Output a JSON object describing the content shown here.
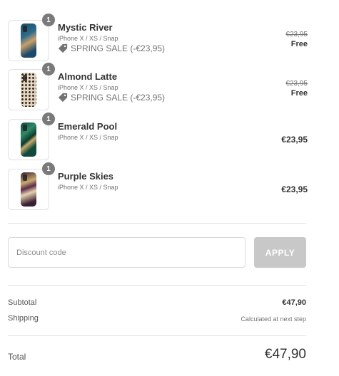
{
  "items": [
    {
      "quantity": "1",
      "name": "Mystic River",
      "variant": "iPhone X / XS / Snap",
      "discount": "SPRING SALE (-€23,95)",
      "original_price": "€23,95",
      "price": "Free",
      "colors": [
        "#1c4a6b",
        "#c9a06a"
      ]
    },
    {
      "quantity": "1",
      "name": "Almond Latte",
      "variant": "iPhone X / XS / Snap",
      "discount": "SPRING SALE (-€23,95)",
      "original_price": "€23,95",
      "price": "Free",
      "colors": [
        "#e3d6c2",
        "#3a2c22"
      ]
    },
    {
      "quantity": "1",
      "name": "Emerald Pool",
      "variant": "iPhone X / XS / Snap",
      "price": "€23,95",
      "colors": [
        "#0f4a3a",
        "#2f8a68"
      ]
    },
    {
      "quantity": "1",
      "name": "Purple Skies",
      "variant": "iPhone X / XS / Snap",
      "price": "€23,95",
      "colors": [
        "#3a1f33",
        "#c9a86e"
      ]
    }
  ],
  "discount_field": {
    "placeholder": "Discount code",
    "apply_label": "APPLY"
  },
  "summary": {
    "subtotal_label": "Subtotal",
    "subtotal_value": "€47,90",
    "shipping_label": "Shipping",
    "shipping_value": "Calculated at next step",
    "total_label": "Total",
    "total_value": "€47,90"
  },
  "icons": {
    "discount": "tag-icon"
  },
  "colors": {
    "badge": "#7a7a7a",
    "apply_button": "#c8c8c8",
    "border": "#e1e1e1"
  }
}
